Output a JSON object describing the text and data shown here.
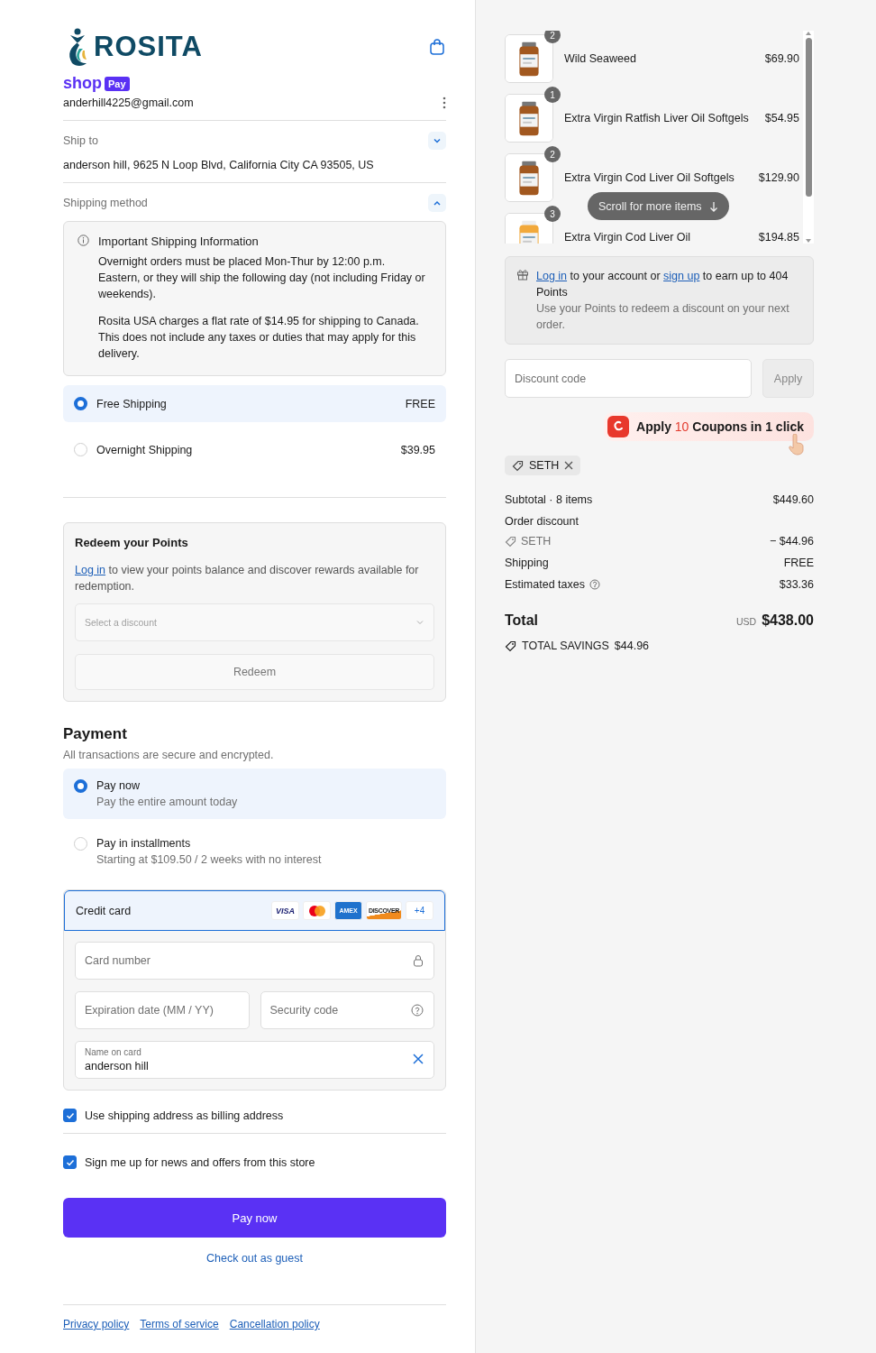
{
  "brand": {
    "logo_text": "ROSITA",
    "shop": "shop",
    "pay": "Pay"
  },
  "contact": {
    "email": "anderhill4225@gmail.com"
  },
  "ship_to": {
    "label": "Ship to",
    "address": "anderson hill, 9625 N Loop Blvd, California City CA 93505, US",
    "expanded": false
  },
  "shipping_method": {
    "label": "Shipping method",
    "expanded": true,
    "notice": {
      "title": "Important Shipping Information",
      "paragraphs": [
        "Overnight orders must be placed Mon-Thur by 12:00 p.m. Eastern, or they will ship the following day (not including Friday or weekends).",
        "Rosita USA charges a flat rate of $14.95 for shipping to Canada. This does not include any taxes or duties that may apply for this delivery."
      ]
    },
    "options": [
      {
        "label": "Free Shipping",
        "price": "FREE",
        "selected": true
      },
      {
        "label": "Overnight Shipping",
        "price": "$39.95",
        "selected": false
      }
    ]
  },
  "redeem": {
    "title": "Redeem your Points",
    "link": "Log in",
    "text": " to view your points balance and discover rewards available for redemption.",
    "select_placeholder": "Select a discount",
    "button": "Redeem"
  },
  "payment": {
    "title": "Payment",
    "subtitle": "All transactions are secure and encrypted.",
    "options": [
      {
        "label": "Pay now",
        "detail": "Pay the entire amount today",
        "selected": true
      },
      {
        "label": "Pay in installments",
        "detail": "Starting at $109.50 / 2 weeks with no interest",
        "selected": false
      }
    ],
    "card": {
      "label": "Credit card",
      "brands": [
        {
          "kind": "visa",
          "label": "VISA"
        },
        {
          "kind": "mastercard"
        },
        {
          "kind": "amex",
          "label": "AMEX"
        },
        {
          "kind": "discover",
          "label": "DISCOVER"
        },
        {
          "kind": "more",
          "label": "+4"
        }
      ],
      "fields": [
        {
          "kind": "lock",
          "placeholder": "Card number"
        },
        {
          "kind": "plain",
          "placeholder": "Expiration date (MM / YY)"
        },
        {
          "kind": "help",
          "placeholder": "Security code"
        },
        {
          "kind": "clear",
          "label": "Name on card",
          "value": "anderson hill"
        }
      ]
    }
  },
  "checkboxes": [
    {
      "label": "Use shipping address as billing address",
      "checked": true
    },
    {
      "label": "Sign me up for news and offers from this store",
      "checked": true
    }
  ],
  "pay_button": "Pay now",
  "guest_link": "Check out as guest",
  "footer_links": [
    "Privacy policy",
    "Terms of service",
    "Cancellation policy"
  ],
  "cart": {
    "items": [
      {
        "quantity": "2",
        "name": "Wild Seaweed",
        "price": "$69.90"
      },
      {
        "quantity": "1",
        "name": "Extra Virgin Ratfish Liver Oil Softgels",
        "price": "$54.95"
      },
      {
        "quantity": "2",
        "name": "Extra Virgin Cod Liver Oil Softgels",
        "price": "$129.90"
      },
      {
        "quantity": "3",
        "name": "Extra Virgin Cod Liver Oil",
        "price": "$194.85"
      }
    ],
    "scroll_hint": "Scroll for more items"
  },
  "rewards": {
    "login_link": "Log in",
    "text_1": " to your account or ",
    "signup_link": "sign up",
    "text_2": " to earn up to ",
    "points": "404 Points",
    "detail": "Use your Points to redeem a discount on your next order."
  },
  "discount": {
    "placeholder": "Discount code",
    "button": "Apply"
  },
  "coupon_popup": {
    "before": "Apply",
    "count": "10",
    "after": "Coupons in 1 click"
  },
  "applied_code": "SETH",
  "summary": {
    "subtotal": {
      "label": "Subtotal · 8 items",
      "value": "$449.60"
    },
    "discount": {
      "label": "Order discount",
      "code": "SETH",
      "value": "− $44.96"
    },
    "shipping": {
      "label": "Shipping",
      "value": "FREE"
    },
    "taxes": {
      "label": "Estimated taxes",
      "value": "$33.36"
    },
    "total": {
      "label": "Total",
      "currency": "USD",
      "value": "$438.00"
    },
    "savings": {
      "label": "TOTAL SAVINGS",
      "value": "$44.96"
    }
  }
}
